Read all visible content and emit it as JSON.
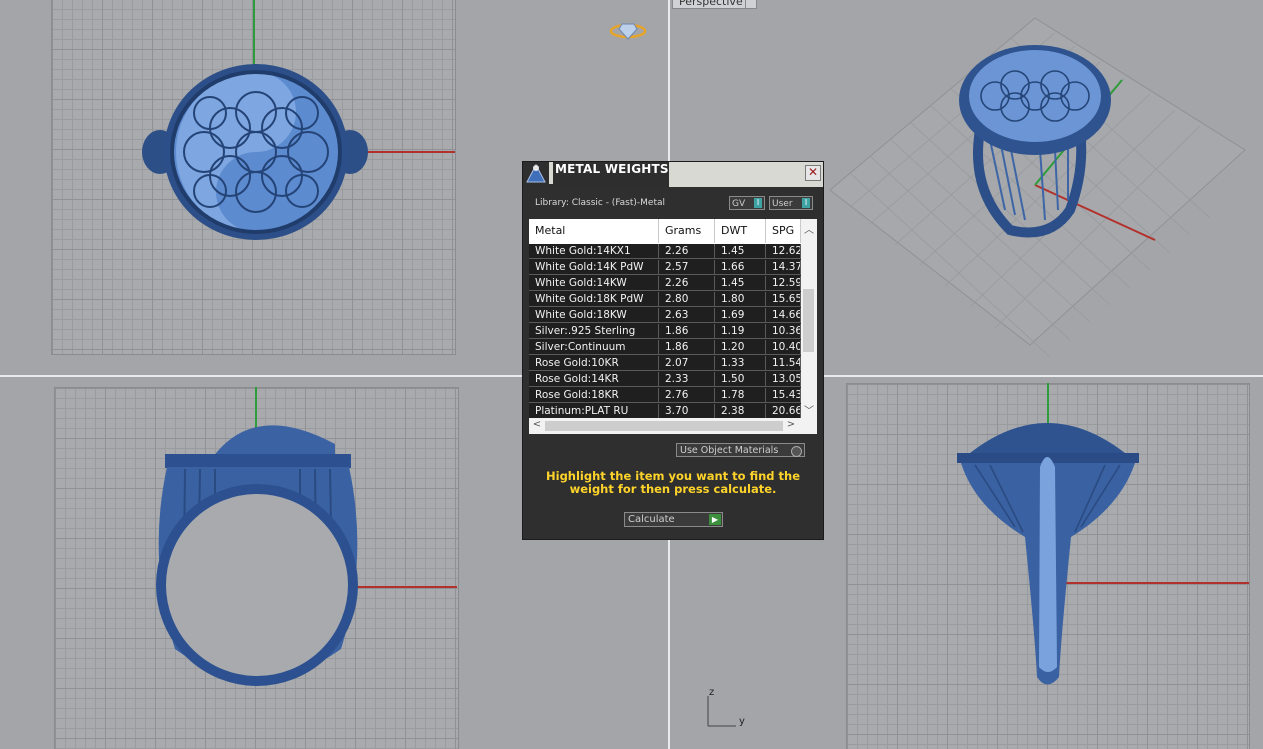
{
  "viewports": {
    "perspective_label": "Perspective"
  },
  "axis_indicator": {
    "z": "z",
    "y": "y"
  },
  "dialog": {
    "title": "METAL WEIGHTS",
    "close_label": "✕",
    "library_label": "Library: Classic - (Fast)-Metal",
    "toggle_gv": "GV",
    "toggle_user": "User",
    "toggle_indicator": "I",
    "columns": [
      "Metal",
      "Grams",
      "DWT",
      "SPG"
    ],
    "rows": [
      [
        "White Gold:14KX1",
        "2.26",
        "1.45",
        "12.62"
      ],
      [
        "White Gold:14K PdW",
        "2.57",
        "1.66",
        "14.37"
      ],
      [
        "White Gold:14KW",
        "2.26",
        "1.45",
        "12.59"
      ],
      [
        "White Gold:18K PdW",
        "2.80",
        "1.80",
        "15.65"
      ],
      [
        "White Gold:18KW",
        "2.63",
        "1.69",
        "14.66"
      ],
      [
        "Silver:.925 Sterling",
        "1.86",
        "1.19",
        "10.36"
      ],
      [
        "Silver:Continuum",
        "1.86",
        "1.20",
        "10.40"
      ],
      [
        "Rose Gold:10KR",
        "2.07",
        "1.33",
        "11.54"
      ],
      [
        "Rose Gold:14KR",
        "2.33",
        "1.50",
        "13.05"
      ],
      [
        "Rose Gold:18KR",
        "2.76",
        "1.78",
        "15.43"
      ],
      [
        "Platinum:PLAT RU",
        "3.70",
        "2.38",
        "20.66"
      ]
    ],
    "use_object_materials": "Use Object Materials",
    "hint": "Highlight the item you want to find the weight for then press calculate.",
    "calculate_label": "Calculate"
  },
  "colors": {
    "ring_blue": "#3d6fb5",
    "x_axis": "#b3312d",
    "y_axis": "#2e9c3a",
    "hint_text": "#ffd42a"
  },
  "icons": [
    "diamond-ring-icon",
    "app-logo-icon",
    "close-icon",
    "scroll-up-icon",
    "scroll-down-icon",
    "scroll-left-icon",
    "scroll-right-icon",
    "calculate-go-icon"
  ]
}
